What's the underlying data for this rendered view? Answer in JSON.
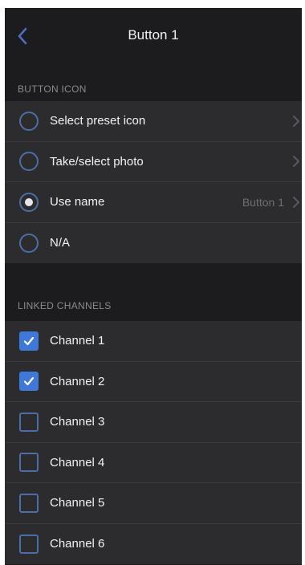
{
  "nav": {
    "back_icon": "chevron-left-icon",
    "title": "Button 1"
  },
  "button_icon_section": {
    "header": "BUTTON ICON",
    "options": [
      {
        "label": "Select preset icon",
        "value": "",
        "selected": false,
        "has_chevron": true
      },
      {
        "label": "Take/select photo",
        "value": "",
        "selected": false,
        "has_chevron": true
      },
      {
        "label": "Use name",
        "value": "Button 1",
        "selected": true,
        "has_chevron": true
      },
      {
        "label": "N/A",
        "value": "",
        "selected": false,
        "has_chevron": false
      }
    ]
  },
  "linked_channels_section": {
    "header": "LINKED CHANNELS",
    "channels": [
      {
        "label": "Channel 1",
        "checked": true
      },
      {
        "label": "Channel 2",
        "checked": true
      },
      {
        "label": "Channel 3",
        "checked": false
      },
      {
        "label": "Channel 4",
        "checked": false
      },
      {
        "label": "Channel 5",
        "checked": false
      },
      {
        "label": "Channel 6",
        "checked": false
      }
    ]
  },
  "colors": {
    "background": "#1c1c1e",
    "row_background": "#2c2c2e",
    "accent": "#3f78d6",
    "outline": "#4b6ea7"
  }
}
